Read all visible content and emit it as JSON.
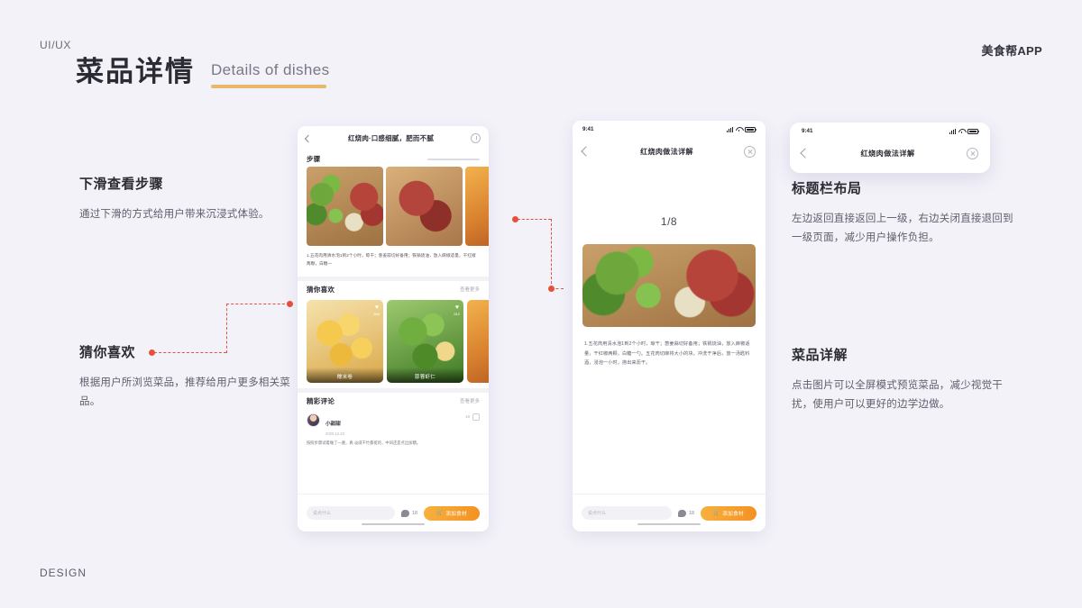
{
  "header": {
    "kicker": "UI/UX",
    "title_cn": "菜品详情",
    "title_en": "Details of dishes",
    "brand": "美食帮APP",
    "footer": "DESIGN"
  },
  "annotations": [
    {
      "id": "scroll-steps",
      "heading": "下滑查看步骤",
      "body": "通过下滑的方式给用户带来沉浸式体验。"
    },
    {
      "id": "guess-you-like",
      "heading": "猜你喜欢",
      "body": "根据用户所浏览菜品，推荐给用户更多相关菜品。"
    },
    {
      "id": "title-bar-layout",
      "heading": "标题栏布局",
      "body": "左边返回直接返回上一级，右边关闭直接退回到一级页面，减少用户操作负担。"
    },
    {
      "id": "dish-detail",
      "heading": "菜品详解",
      "body": "点击图片可以全屏模式预览菜品，减少视觉干扰，使用户可以更好的边学边做。"
    }
  ],
  "phone1": {
    "nav_title": "红烧肉·口感细腻，肥而不腻",
    "back_icon": "chevron-left-icon",
    "timer_icon": "timer-icon",
    "steps_section": {
      "title": "步骤",
      "step_text": "1.五花肉用清水泡1到2个小时，晾干；葱姜蒜切好备用；铁锅烧油，放入麻椒适量，干红椒两颗，白糖一"
    },
    "likes_section": {
      "title": "猜你喜欢",
      "more": "查看更多",
      "cards": [
        {
          "label": "糯米卷",
          "likes": "866"
        },
        {
          "label": "蒜蓉虾仁",
          "likes": "512"
        },
        {
          "label": "",
          "likes": ""
        }
      ]
    },
    "comments_section": {
      "title": "精彩评论",
      "more": "查看更多",
      "user": "小甜甜",
      "date": "2020.12.22",
      "like_count": "18",
      "body": "按照步骤试着做了一遍，真·淡咸干忙都挺的，中间还是点出加糖。"
    },
    "bottom": {
      "input_placeholder": "说点什么",
      "comment_count": "18",
      "add_button": "添加食材"
    }
  },
  "phone2": {
    "status_time": "9:41",
    "nav_title": "红烧肉做法详解",
    "back_icon": "chevron-left-icon",
    "close_icon": "close-circle-icon",
    "counter": "1/8",
    "step_text": "1.五花肉用清水泡1到2个小时，晾干；葱姜蒜切好备用；铁锅烧油，放入麻椒适量，干红椒两颗，白糖一勺。五花肉切麻将大小的块，冲洗干净后，放一汤匙料酒，浸泡一小时，捞出来沥干。",
    "bottom": {
      "input_placeholder": "说点什么",
      "comment_count": "18",
      "add_button": "添加食材"
    }
  },
  "detail_card": {
    "status_time": "9:41",
    "nav_title": "红烧肉做法详解",
    "back_icon": "chevron-left-icon",
    "close_icon": "close-circle-icon"
  },
  "colors": {
    "background": "#f3f2f9",
    "accent_underline": "#e8b96a",
    "connector": "#e8503a",
    "cta_button": "#f49122"
  }
}
